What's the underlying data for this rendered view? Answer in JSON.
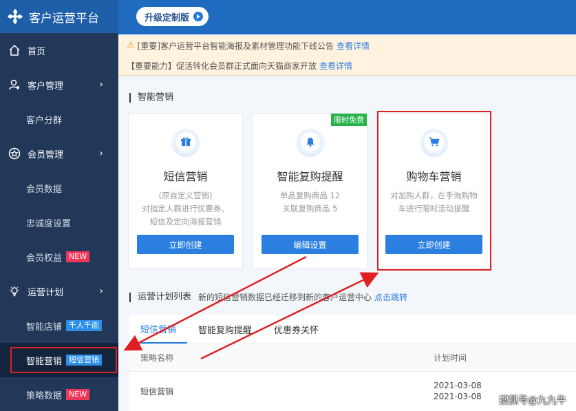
{
  "brand": {
    "title": "客户运营平台"
  },
  "topbar": {
    "upgrade_label": "升级定制版"
  },
  "notices": [
    {
      "text": "[重要]客户运营平台智能海报及素材管理功能下线公告",
      "link": "查看详情"
    },
    {
      "text": "【重要能力】促活转化会员群正式面向天猫商家开放",
      "link": "查看详情"
    }
  ],
  "sidebar": {
    "items": [
      {
        "label": "首页"
      },
      {
        "label": "客户管理"
      },
      {
        "label": "客户分群"
      },
      {
        "label": "会员管理"
      },
      {
        "label": "会员数据"
      },
      {
        "label": "忠诚度设置"
      },
      {
        "label": "会员权益",
        "badge": "NEW"
      },
      {
        "label": "运营计划"
      },
      {
        "label": "智能店铺",
        "badge": "千人千面"
      },
      {
        "label": "智能营销",
        "badge": "短信营销"
      },
      {
        "label": "策略数据",
        "badge": "NEW"
      }
    ]
  },
  "main": {
    "section_title": "智能营销",
    "cards": [
      {
        "title": "短信营销",
        "desc": [
          "(原自定义营销)",
          "对指定人群进行优惠券、",
          "短信及定向海报营销"
        ],
        "button": "立即创建",
        "icon": "gift-icon"
      },
      {
        "title": "智能复购提醒",
        "desc": [
          "单品复购商品 12",
          "关联复购商品 5"
        ],
        "button": "编辑设置",
        "tag": "限时免费",
        "icon": "bell-icon"
      },
      {
        "title": "购物车营销",
        "desc": [
          "对加购人群，在手淘购物",
          "车进行限时活动提醒"
        ],
        "button": "立即创建",
        "icon": "cart-icon"
      }
    ],
    "plan": {
      "title": "运营计划列表",
      "notice": "新的短信营销数据已经迁移到新的客户运营中心",
      "link": "点击跳转",
      "tabs": [
        "短信营销",
        "智能复购提醒",
        "优惠券关怀"
      ],
      "columns": [
        "策略名称",
        "计划时间"
      ],
      "rows": [
        {
          "name": "短信营销",
          "time1": "2021-03-08",
          "time2": "2021-03-08"
        }
      ]
    }
  },
  "watermark": "搜狐号@九九牛",
  "colors": {
    "sidebar": "#213859",
    "brand": "#1f5faa",
    "accent": "#2b7fe0",
    "highlight": "#e02020"
  }
}
